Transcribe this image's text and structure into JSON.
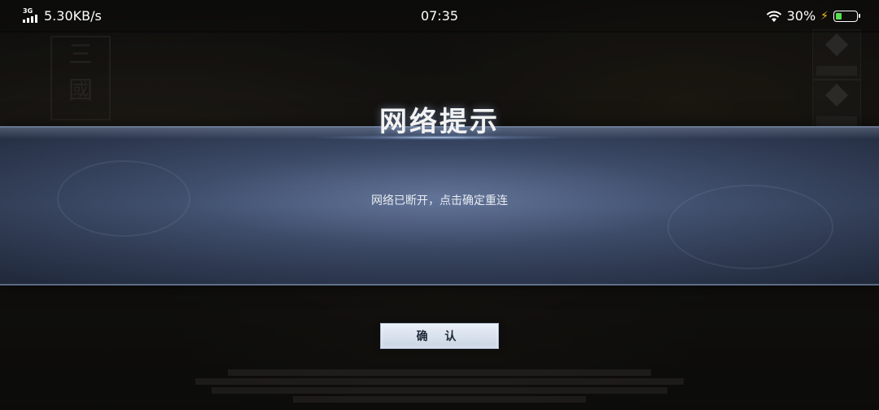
{
  "status_bar": {
    "network_type": "3G",
    "speed": "5.30KB/s",
    "time": "07:35",
    "battery": "30%",
    "battery_level": 0.3,
    "battery_color": "#57e04d"
  },
  "dialog": {
    "title": "网络提示",
    "message": "网络已断开，点击确定重连",
    "confirm_label": "确 认"
  },
  "icons": [
    "signal-icon",
    "wifi-icon",
    "charging-icon",
    "battery-icon"
  ],
  "colors": {
    "dialog_band": "#4a5a7a",
    "button_bg": "#dde5f0",
    "button_text": "#1f2a3a"
  }
}
